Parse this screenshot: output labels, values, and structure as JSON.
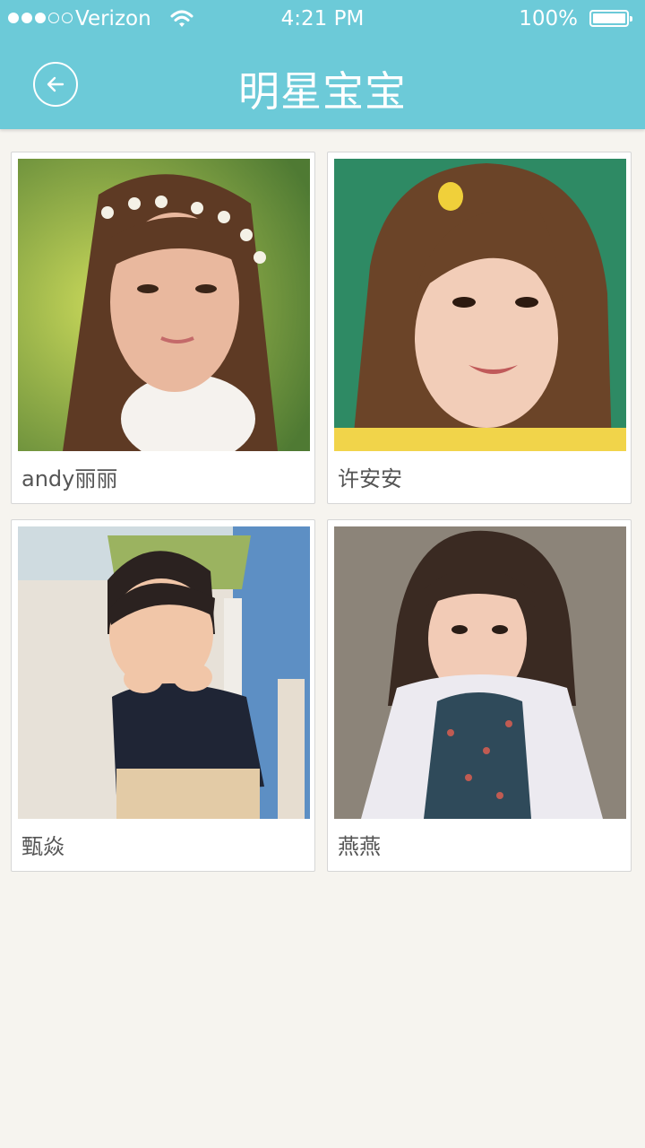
{
  "status_bar": {
    "carrier": "Verizon",
    "time": "4:21 PM",
    "battery": "100%",
    "signal_bars": 3,
    "signal_total": 5
  },
  "header": {
    "title": "明星宝宝",
    "back_icon": "back-arrow-circle-icon",
    "background_color": "#6ccad8"
  },
  "babies": [
    {
      "name": "andy丽丽"
    },
    {
      "name": "许安安"
    },
    {
      "name": "甄焱"
    },
    {
      "name": "燕燕"
    }
  ]
}
